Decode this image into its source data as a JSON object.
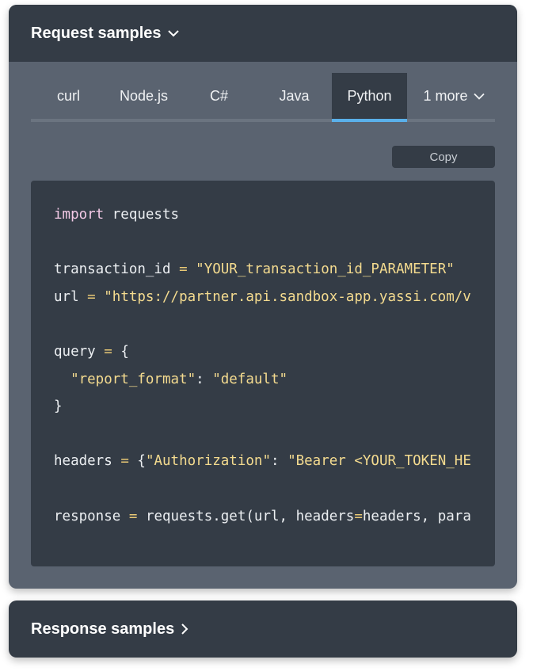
{
  "request": {
    "title": "Request samples",
    "tabs": [
      "curl",
      "Node.js",
      "C#",
      "Java",
      "Python"
    ],
    "active_tab": "Python",
    "more_label": "1 more",
    "copy_label": "Copy",
    "code": {
      "import_kw": "import",
      "import_mod": " requests",
      "var_tid": "transaction_id",
      "val_tid": "\"YOUR_transaction_id_PARAMETER\"",
      "var_url": "url",
      "val_url": "\"https://partner.api.sandbox-app.yassi.com/v",
      "var_query": "query",
      "brace_open": "{",
      "query_key": "\"report_format\"",
      "colon": ": ",
      "query_val": "\"default\"",
      "brace_close": "}",
      "var_headers": "headers",
      "headers_open": "{",
      "headers_key": "\"Authorization\"",
      "headers_val": "\"Bearer <YOUR_TOKEN_HE",
      "var_response": "response",
      "call_a": "requests.get(url, headers",
      "call_b": "headers, para",
      "assign": "="
    }
  },
  "response": {
    "title": "Response samples"
  },
  "colors": {
    "header_bg": "#343c46",
    "panel_bg": "#5a6370",
    "accent": "#5ab0ea",
    "keyword": "#f3c9e6",
    "string": "#f4db8f"
  }
}
